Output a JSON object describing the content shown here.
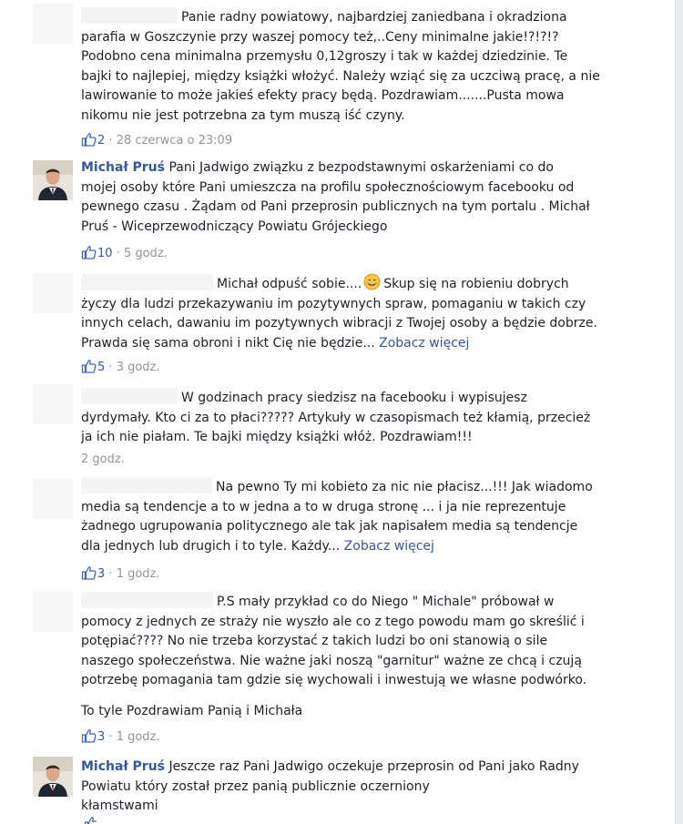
{
  "comments": [
    {
      "author": "",
      "lines": [
        "Panie radny powiatowy, najbardziej zaniedbana i okradziona",
        "parafia w Goszczynie przy waszej pomocy też,..Ceny minimalne jakie!?!?!?",
        "Podobno cena minimalna przemysłu 0,12groszy i tak w każdej dziedzinie. Te",
        "bajki to najlepiej, między książki włożyć. Należy wziąć się za uczciwą pracę, a nie",
        "lawirowanie to może jakieś efekty pracy będą. Pozdrawiam.......Pusta mowa",
        "nikomu nie jest potrzebna za tym muszą iść czyny."
      ],
      "likes": "2",
      "time": "28 czerwca o 23:09"
    },
    {
      "author": "Michał Pruś",
      "lines": [
        "Pani Jadwigo związku z bezpodstawnymi oskarżeniami co do",
        "mojej osoby które Pani umieszcza na profilu społecznościowym facebooku od",
        "pewnego czasu . Żądam od Pani przeprosin publicznych na tym portalu . Michał",
        "Pruś - Wiceprzewodniczący Powiatu Grójeckiego"
      ],
      "likes": "10",
      "time": "5 godz."
    },
    {
      "author": "",
      "lines": [
        "Michał odpuść sobie....",
        "Skup się na robieniu dobrych",
        "życzy dla ludzi przekazywaniu im pozytywnych spraw, pomaganiu w takich czy",
        "innych celach, dawaniu im pozytywnych wibracji z Twojej osoby a będzie dobrze.",
        "Prawda się sama obroni i nikt Cię nie będzie..."
      ],
      "see_more": "Zobacz więcej",
      "likes": "5",
      "time": "3 godz."
    },
    {
      "author": "",
      "lines": [
        "W godzinach pracy siedzisz na facebooku i wypisujesz",
        "dyrdymały. Kto ci za to płaci????? Artykuły w czasopismach też kłamią, przecież",
        "ja ich nie piałam. Te bajki między książki włóż. Pozdrawiam!!!"
      ],
      "time": "2 godz."
    },
    {
      "author": "",
      "lines": [
        "Na pewno Ty mi kobieto za nic nie płacisz...!!! Jak wiadomo",
        "media są tendencje a to w jedna a to w druga stronę ... i ja nie reprezentuje",
        "żadnego ugrupowania politycznego ale tak jak napisałem media są tendencje",
        "dla jednych lub drugich i to tyle. Każdy..."
      ],
      "see_more": "Zobacz więcej",
      "likes": "3",
      "time": "1 godz."
    },
    {
      "author": "",
      "lines": [
        "P.S mały przykład co do Niego \" Michale\" próbował w",
        "pomocy z jednych ze straży nie wyszło ale co z tego powodu mam go skreślić i",
        "potępiać???? No nie trzeba korzystać z takich ludzi bo oni stanowią o sile",
        "naszego społeczeństwa. Nie ważne jaki noszą \"garnitur\" ważne ze chcą i czują",
        "potrzebę pomagania tam gdzie się wychowali i inwestują we własne podwórko."
      ],
      "extra": "To tyle Pozdrawiam Panią i Michała",
      "likes": "3",
      "time": "1 godz."
    },
    {
      "author": "Michał Pruś",
      "lines": [
        "Jeszcze raz Pani Jadwigo oczekuje przeprosin od Pani jako Radny",
        "Powiatu który został przez panią publicznie oczerniony",
        "kłamstwami"
      ]
    }
  ],
  "separator": " · ",
  "colors": {
    "link": "#365899",
    "meta": "#90949c",
    "text": "#1d2129"
  },
  "icons": {
    "like": "thumbs-up-icon",
    "emoji": "smiling-face-icon"
  }
}
